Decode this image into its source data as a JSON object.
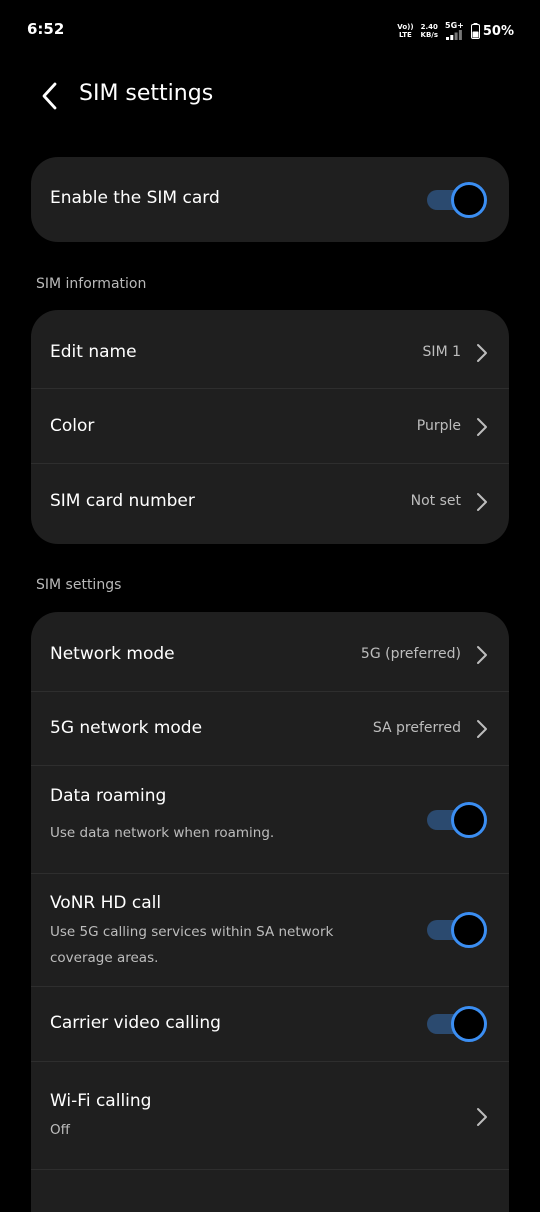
{
  "status_bar": {
    "time": "6:52",
    "volte_top": "Vo))",
    "volte_bottom": "LTE",
    "speed_value": "2.40",
    "speed_unit": "KB/s",
    "network_type": "5G+",
    "battery": "50%"
  },
  "header": {
    "title": "SIM settings"
  },
  "enable_card": {
    "label": "Enable the SIM card",
    "enabled": true
  },
  "sim_information": {
    "section_label": "SIM information",
    "items": [
      {
        "title": "Edit name",
        "value": "SIM 1"
      },
      {
        "title": "Color",
        "value": "Purple"
      },
      {
        "title": "SIM card number",
        "value": "Not set"
      }
    ]
  },
  "sim_settings": {
    "section_label": "SIM settings",
    "network_mode": {
      "title": "Network mode",
      "value": "5G (preferred)"
    },
    "fiveg_mode": {
      "title": "5G network mode",
      "value": "SA preferred"
    },
    "data_roaming": {
      "title": "Data roaming",
      "subtitle": "Use data network when roaming.",
      "enabled": true
    },
    "vonr": {
      "title": "VoNR HD call",
      "subtitle": "Use 5G calling services within SA network coverage areas.",
      "enabled": true
    },
    "carrier_video": {
      "title": "Carrier video calling",
      "enabled": true
    },
    "wifi_calling": {
      "title": "Wi-Fi calling",
      "subtitle": "Off"
    }
  },
  "colors": {
    "background": "#000000",
    "card": "#1f1f1f",
    "toggle_accent": "#3b8ef2",
    "toggle_track": "#2b4a6f"
  }
}
